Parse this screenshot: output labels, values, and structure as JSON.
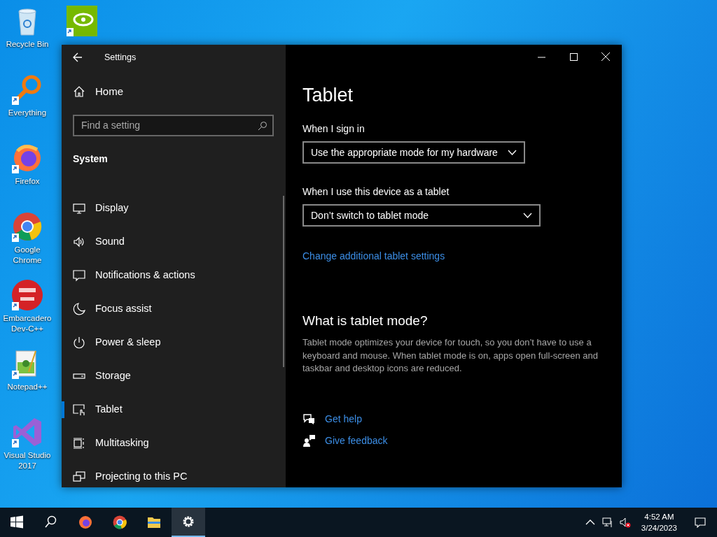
{
  "desktop_icons": [
    {
      "kind": "recycle",
      "label": "Recycle Bin"
    },
    {
      "kind": "everything",
      "label": "Everything"
    },
    {
      "kind": "firefox",
      "label": "Firefox"
    },
    {
      "kind": "chrome",
      "label": "Google Chrome"
    },
    {
      "kind": "devcpp",
      "label": "Embarcadero Dev-C++"
    },
    {
      "kind": "notepad",
      "label": "Notepad++"
    },
    {
      "kind": "vs",
      "label": "Visual Studio 2017"
    },
    {
      "kind": "nvidia"
    }
  ],
  "window": {
    "title": "Settings",
    "sidebar": {
      "home": "Home",
      "search": {
        "placeholder": "Find a setting"
      },
      "section": "System",
      "items": [
        {
          "kind": "display",
          "label": "Display",
          "selected": false
        },
        {
          "kind": "sound",
          "label": "Sound",
          "selected": false
        },
        {
          "kind": "notifications",
          "label": "Notifications & actions",
          "selected": false
        },
        {
          "kind": "focus",
          "label": "Focus assist",
          "selected": false
        },
        {
          "kind": "power",
          "label": "Power & sleep",
          "selected": false
        },
        {
          "kind": "storage",
          "label": "Storage",
          "selected": false
        },
        {
          "kind": "tablet",
          "label": "Tablet",
          "selected": true
        },
        {
          "kind": "multitasking",
          "label": "Multitasking",
          "selected": false
        },
        {
          "kind": "projecting",
          "label": "Projecting to this PC",
          "selected": false
        }
      ]
    },
    "content": {
      "title": "Tablet",
      "settings": [
        {
          "label": "When I sign in",
          "value": "Use the appropriate mode for my hardware"
        },
        {
          "label": "When I use this device as a tablet",
          "value": "Don’t switch to tablet mode"
        }
      ],
      "link": "Change additional tablet settings",
      "heading": "What is tablet mode?",
      "description": "Tablet mode optimizes your device for touch, so you don’t have to use a keyboard and mouse. When tablet mode is on, apps open full-screen and taskbar and desktop icons are reduced.",
      "help_links": [
        {
          "kind": "help",
          "label": "Get help"
        },
        {
          "kind": "feedback",
          "label": "Give feedback"
        }
      ]
    }
  },
  "taskbar": {
    "apps": [
      {
        "kind": "start",
        "active": false
      },
      {
        "kind": "search",
        "active": false
      },
      {
        "kind": "firefox",
        "active": false
      },
      {
        "kind": "chrome",
        "active": false
      },
      {
        "kind": "explorer",
        "active": false
      },
      {
        "kind": "settings",
        "active": true
      }
    ],
    "time": "4:52 AM",
    "date": "3/24/2023"
  }
}
